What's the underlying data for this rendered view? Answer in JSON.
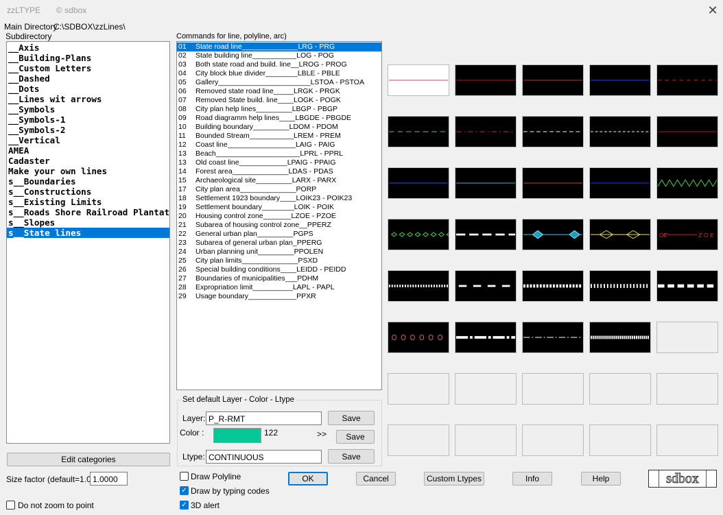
{
  "window": {
    "title": "zzLTYPE",
    "copyright": "© sdbox",
    "close_icon": "close-icon"
  },
  "main_dir": {
    "label": "Main Directory",
    "path": "C:\\SDBOX\\zzLines\\"
  },
  "subdirectory": {
    "label": "Subdirectory",
    "items": [
      "__Axis",
      "__Building-Plans",
      "__Custom Letters",
      "__Dashed",
      "__Dots",
      "__Lines wit arrows",
      "__Symbols",
      "__Symbols-1",
      "__Symbols-2",
      "__Vertical",
      "AMEA",
      "Cadaster",
      "Make your own lines",
      "s__Boundaries",
      "s__Constructions",
      "s__Existing Limits",
      "s__Roads Shore Railroad Plantati",
      "s__Slopes",
      "s__State lines"
    ],
    "selected_index": 18
  },
  "commands": {
    "label": "Commands for line, polyline, arc)",
    "items": [
      {
        "num": "01",
        "text": "State road line______________LRG - PRG"
      },
      {
        "num": "02",
        "text": "State building line___________LOG - POG"
      },
      {
        "num": "03",
        "text": "Both state road and build. line__LROG - PROG"
      },
      {
        "num": "04",
        "text": "City block blue divider________LBLE - PBLE"
      },
      {
        "num": "05",
        "text": "Gallery_______________________LSTOA - PSTOA"
      },
      {
        "num": "06",
        "text": "Removed state road line_____LRGK - PRGK"
      },
      {
        "num": "07",
        "text": "Removed State build. line____LOGK - POGK"
      },
      {
        "num": "08",
        "text": "City plan help lines_________LBGP - PBGP"
      },
      {
        "num": "09",
        "text": "Road diagramm help lines____LBGDE - PBGDE"
      },
      {
        "num": "10",
        "text": "Building boundary_________LDOM - PDOM"
      },
      {
        "num": "11",
        "text": "Bounded Stream___________LREM - PREM"
      },
      {
        "num": "12",
        "text": "Coast line_________________LAIG - PAIG"
      },
      {
        "num": "13",
        "text": "Beach_____________________LPRL - PPRL"
      },
      {
        "num": "13",
        "text": "Old coast line____________LPAIG - PPAIG"
      },
      {
        "num": "14",
        "text": "Forest area______________LDAS - PDAS"
      },
      {
        "num": "15",
        "text": "Archaeological site_________LARX - PARX"
      },
      {
        "num": "17",
        "text": "City plan area______________PORP"
      },
      {
        "num": "18",
        "text": "Settlement 1923 boundary____LOIK23 - POIK23"
      },
      {
        "num": "19",
        "text": "Settlement boundary________LOIK - POIK"
      },
      {
        "num": "20",
        "text": "Housing control zone_______LZOE - PZOE"
      },
      {
        "num": "21",
        "text": "Subarea of housing control zone__PPERZ"
      },
      {
        "num": "22",
        "text": "General urban plan_________PGPS"
      },
      {
        "num": "23",
        "text": "Subarea of general urban plan_PPERG"
      },
      {
        "num": "24",
        "text": "Urban planning unit_________PPOLEN"
      },
      {
        "num": "25",
        "text": "City plan limits______________PSXD"
      },
      {
        "num": "26",
        "text": "Special building conditions____LEIDD - PEIDD"
      },
      {
        "num": "27",
        "text": "Boundaries of municipalities___PDHM"
      },
      {
        "num": "28",
        "text": "Expropriation limit__________LAPL - PAPL"
      },
      {
        "num": "29",
        "text": "Usage boundary____________PPXR"
      }
    ],
    "selected_index": 0
  },
  "defaults": {
    "group_label": "Set default Layer - Color - Ltype",
    "layer_label": "Layer:",
    "layer_value": "P_R-RMT",
    "color_label": "Color  :",
    "color_swatch": "#00c896",
    "color_number": "122",
    "color_more": ">>",
    "ltype_label": "Ltype:",
    "ltype_value": "CONTINUOUS",
    "save_label": "Save"
  },
  "left_controls": {
    "edit_categories": "Edit categories",
    "size_label": "Size factor (default=1.0):",
    "size_value": "1.0000",
    "no_zoom_label": "Do not zoom to point",
    "no_zoom_checked": false
  },
  "options": {
    "draw_polyline": "Draw   Polyline",
    "draw_polyline_checked": false,
    "draw_typing": "Draw by typing codes",
    "draw_typing_checked": true,
    "alert_3d": "3D alert",
    "alert_3d_checked": true
  },
  "buttons": {
    "ok": "OK",
    "cancel": "Cancel",
    "custom": "Custom Ltypes",
    "info": "Info",
    "help": "Help"
  },
  "logo": {
    "text": "sdbox"
  },
  "tile_text": {
    "zoe_left": "OE",
    "zoe_right": "Z O E"
  },
  "preview_tiles": [
    "state-road-line",
    "state-building-line",
    "both-state-road-and-building-line",
    "city-block-blue-divider",
    "gallery",
    "removed-state-road-line",
    "removed-state-building-line",
    "city-plan-help-lines",
    "road-diagramm-help-lines",
    "building-boundary",
    "bounded-stream",
    "coast-line",
    "beach",
    "old-coast-line",
    "forest-area",
    "archaeological-site",
    "city-plan-area",
    "settlement-1923-boundary",
    "settlement-boundary",
    "housing-control-zone",
    "subarea-of-housing-control-zone",
    "general-urban-plan",
    "subarea-of-general-urban-plan",
    "urban-planning-unit",
    "city-plan-limits",
    "special-building-conditions",
    "boundaries-of-municipalities",
    "expropriation-limit",
    "usage-boundary",
    "empty-slot"
  ]
}
